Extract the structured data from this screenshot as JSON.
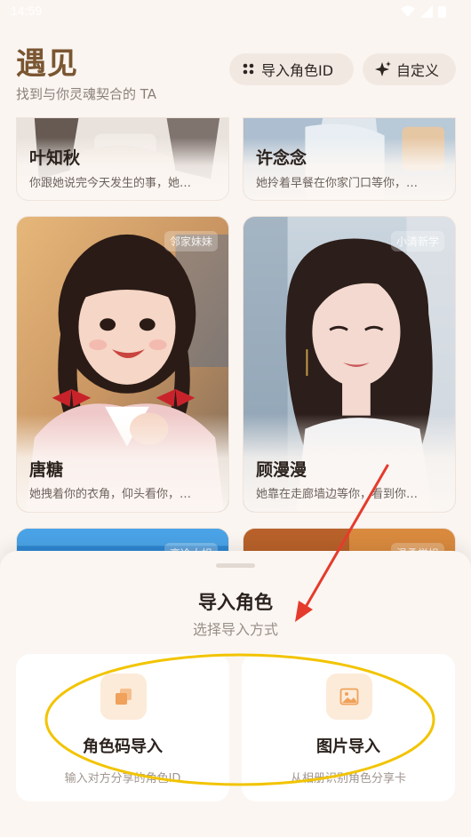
{
  "status": {
    "time": "14:59"
  },
  "header": {
    "title": "遇见",
    "subtitle": "找到与你灵魂契合的 TA",
    "import_button": "导入角色ID",
    "custom_button": "自定义"
  },
  "cards": [
    {
      "name": "叶知秋",
      "desc": "你跟她说完今天发生的事，她…",
      "tag": ""
    },
    {
      "name": "许念念",
      "desc": "她拎着早餐在你家门口等你，…",
      "tag": ""
    },
    {
      "name": "唐糖",
      "desc": "她拽着你的衣角，仰头看你，…",
      "tag": "邻家妹妹"
    },
    {
      "name": "顾漫漫",
      "desc": "她靠在走廊墙边等你，看到你…",
      "tag": "小清新学"
    },
    {
      "name": "",
      "desc": "",
      "tag": "高冷大姐"
    },
    {
      "name": "",
      "desc": "",
      "tag": "温柔学姐"
    }
  ],
  "sheet": {
    "title": "导入角色",
    "subtitle": "选择导入方式",
    "options": [
      {
        "label": "角色码导入",
        "desc": "输入对方分享的角色ID",
        "icon": "copy-icon"
      },
      {
        "label": "图片导入",
        "desc": "从相册识别角色分享卡",
        "icon": "image-icon"
      }
    ]
  },
  "colors": {
    "title_brown": "#7a5632",
    "annotation_red": "#e53b2c",
    "annotation_yellow": "#f2c400",
    "option_icon_bg": "#fcebd9",
    "option_icon_fg": "#f0a15a"
  }
}
